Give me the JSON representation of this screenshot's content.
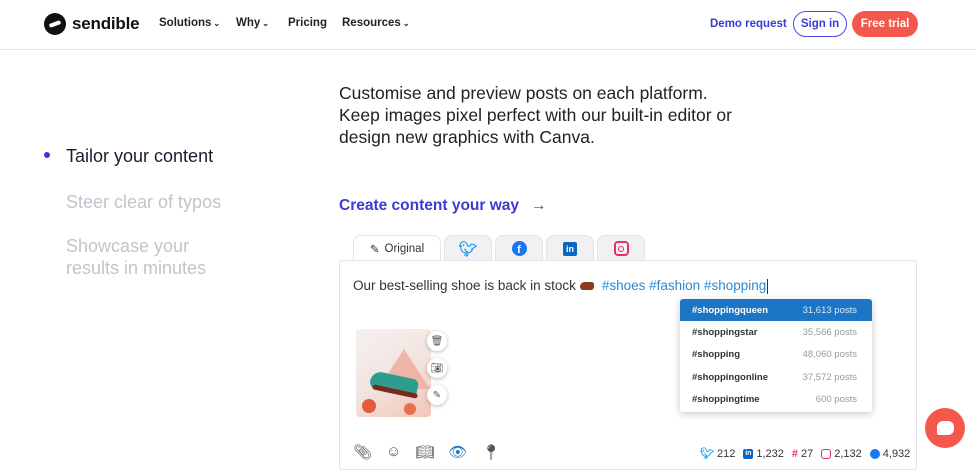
{
  "nav": {
    "logo": "sendible",
    "items": [
      {
        "label": "Solutions",
        "has_dropdown": true
      },
      {
        "label": "Why",
        "has_dropdown": true
      },
      {
        "label": "Pricing",
        "has_dropdown": false
      },
      {
        "label": "Resources",
        "has_dropdown": true
      }
    ],
    "chevron": "⌄",
    "demo_request": "Demo request",
    "sign_in": "Sign in",
    "free_trial": "Free trial"
  },
  "features": {
    "items": [
      {
        "label": "Tailor your content",
        "active": true
      },
      {
        "label": "Steer clear of typos",
        "active": false
      },
      {
        "label": "Showcase your results in minutes",
        "active": false
      }
    ]
  },
  "main": {
    "description": "Customise and preview posts on each platform. Keep images pixel perfect with our built-in editor or design new graphics with Canva.",
    "cta_label": "Create content your way",
    "cta_arrow": "→"
  },
  "composer": {
    "tabs": [
      {
        "label": "Original",
        "icon": "pencil-icon"
      },
      {
        "label": "",
        "icon": "twitter-icon"
      },
      {
        "label": "",
        "icon": "facebook-icon"
      },
      {
        "label": "",
        "icon": "linkedin-icon"
      },
      {
        "label": "",
        "icon": "instagram-icon"
      }
    ],
    "post_text": "Our best-selling shoe is back in stock",
    "hashtags": "#shoes #fashion #shopping",
    "suggestions": [
      {
        "tag": "#shoppingqueen",
        "count": "31,613 posts",
        "selected": true
      },
      {
        "tag": "#shoppingstar",
        "count": "35,566 posts",
        "selected": false
      },
      {
        "tag": "#shopping",
        "count": "48,060 posts",
        "selected": false
      },
      {
        "tag": "#shoppingonline",
        "count": "37,572 posts",
        "selected": false
      },
      {
        "tag": "#shoppingtime",
        "count": "600 posts",
        "selected": false
      }
    ],
    "image_actions": [
      "trash-icon",
      "camera-icon",
      "pencil-icon"
    ],
    "toolbar_icons": [
      "paperclip-icon",
      "smiley-icon",
      "book-icon",
      "eye-icon",
      "location-pin-icon"
    ],
    "character_counts": [
      {
        "network": "twitter",
        "value": "212"
      },
      {
        "network": "linkedin",
        "value": "1,232"
      },
      {
        "network": "hashtags",
        "value": "27"
      },
      {
        "network": "instagram",
        "value": "2,132"
      },
      {
        "network": "facebook",
        "value": "4,932"
      }
    ]
  },
  "colors": {
    "brand_purple": "#3b3bd1",
    "trial_red": "#f4584c",
    "selected_blue": "#1b76c6",
    "hashtag_blue": "#2b8ad6"
  }
}
